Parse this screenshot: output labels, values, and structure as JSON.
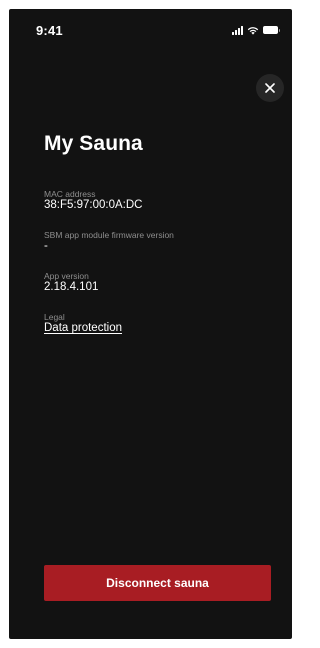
{
  "status_bar": {
    "time": "9:41",
    "icons": [
      "signal-icon",
      "wifi-icon",
      "battery-icon"
    ]
  },
  "header": {
    "close_icon": "close-icon"
  },
  "page": {
    "title": "My Sauna"
  },
  "info": {
    "mac": {
      "label": "MAC address",
      "value": "38:F5:97:00:0A:DC"
    },
    "firmware": {
      "label": "SBM app module firmware version",
      "value": "-"
    },
    "app_version": {
      "label": "App version",
      "value": "2.18.4.101"
    },
    "legal": {
      "label": "Legal",
      "link": "Data protection"
    }
  },
  "actions": {
    "disconnect_label": "Disconnect sauna"
  },
  "colors": {
    "background": "#121212",
    "accent": "#a81d23",
    "label": "#8e8e8e",
    "text": "#ffffff"
  }
}
